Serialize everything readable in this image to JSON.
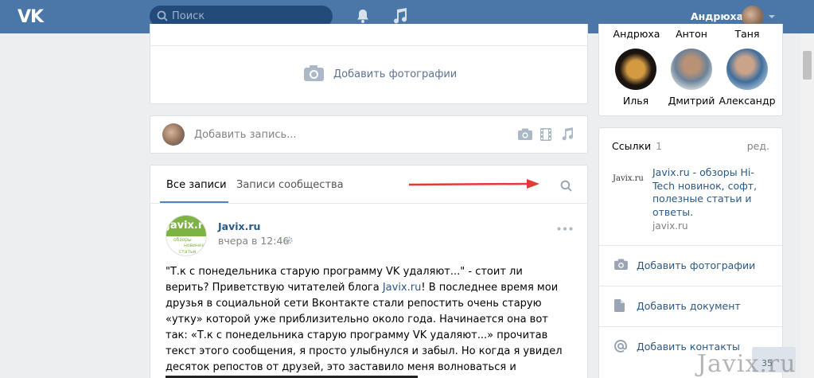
{
  "header": {
    "logo": "VK",
    "search_placeholder": "Поиск",
    "username": "Андрюха"
  },
  "photos_block": {
    "add_photos": "Добавить фотографии"
  },
  "composer": {
    "placeholder": "Добавить запись..."
  },
  "feed": {
    "tabs": [
      {
        "label": "Все записи",
        "active": true
      },
      {
        "label": "Записи сообщества",
        "active": false
      }
    ],
    "post": {
      "avatar_text": "Javix.ru",
      "avatar_small": [
        "обзоры",
        "новинки",
        "статьи"
      ],
      "author": "Javix.ru",
      "time": "вчера в 12:46",
      "text_before_link": "\"Т.к с понедельника старую программу VK удаляют...\" - стоит ли верить? Приветствую читателей блога ",
      "link": "Javix.ru",
      "text_after_link": "! В последнее время мои друзья в социальной сети Вконтакте стали репостить очень старую «утку» которой уже приблизительно около года.  Начинается она вот так: «Т.к с понедельника старую программу VK удаляют...»  прочитав текст этого сообщения, я просто улыбнулся и забыл. Но когда я увидел десяток репостов от друзей, это заставило меня волноваться и написать статью на эту тему..."
    }
  },
  "friends": {
    "top_row": [
      "Андрюха",
      "Антон",
      "Таня"
    ],
    "bottom_row": [
      "Илья",
      "Дмитрий",
      "Александр"
    ]
  },
  "links": {
    "title": "Ссылки",
    "count": "1",
    "edit": "ред.",
    "item_logo": "Javix.ru",
    "item_text": "Javix.ru - обзоры Hi-Tech новинок, софт, полезные статьи и ответы.",
    "item_domain": "javix.ru",
    "actions": [
      "Добавить фотографии",
      "Добавить документ",
      "Добавить контакты"
    ]
  },
  "counter": "35",
  "watermark": "Javix.ru",
  "colors": {
    "header": "#4a76a8",
    "link": "#2a5885",
    "arrow": "#e53935"
  }
}
